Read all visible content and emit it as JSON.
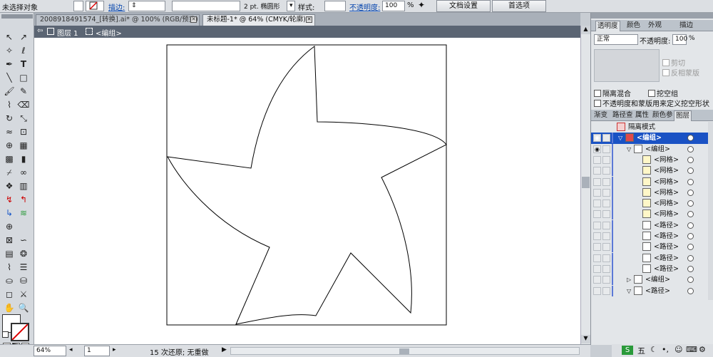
{
  "control_bar": {
    "selection_label": "未选择对象",
    "stroke_label": "描边:",
    "stroke_weight": "2 pt. 椭圆形",
    "style_label": "样式:",
    "opacity_label": "不透明度:",
    "opacity_value": "100",
    "percent": "%",
    "doc_settings_button": "文档设置",
    "preferences_button": "首选项"
  },
  "tabs": [
    {
      "label": "2008918491574_[转换].ai* @ 100% (RGB/预览)"
    },
    {
      "label": "未标题-1* @ 64% (CMYK/轮廓)"
    }
  ],
  "breadcrumb": {
    "layer": "图层 1",
    "group": "<编组>"
  },
  "status_bar": {
    "zoom": "64%",
    "page": "1",
    "undo_text": "15 次还原; 无重做"
  },
  "transparency_panel": {
    "tabs": [
      "透明度",
      "颜色",
      "外观",
      "描边"
    ],
    "blend_mode": "正常",
    "opacity_label": "不透明度:",
    "opacity_value": "100",
    "percent": "%",
    "clip_label": "剪切",
    "invert_mask_label": "反相蒙版",
    "isolate_blending": "隔离混合",
    "knockout_group": "挖空组",
    "opacity_mask_label": "不透明度和蒙版用来定义挖空形状"
  },
  "layers_panel": {
    "tabs": [
      "渐变",
      "路径查",
      "属性",
      "颜色参",
      "图层"
    ],
    "rows": [
      {
        "name": "隔离模式",
        "indent": 0
      },
      {
        "name": "<编组>",
        "indent": 1
      },
      {
        "name": "<编组>",
        "indent": 2
      },
      {
        "name": "<网格>",
        "indent": 3
      },
      {
        "name": "<网格>",
        "indent": 3
      },
      {
        "name": "<网格>",
        "indent": 3
      },
      {
        "name": "<网格>",
        "indent": 3
      },
      {
        "name": "<网格>",
        "indent": 3
      },
      {
        "name": "<网格>",
        "indent": 3
      },
      {
        "name": "<路径>",
        "indent": 3
      },
      {
        "name": "<路径>",
        "indent": 3
      },
      {
        "name": "<路径>",
        "indent": 3
      },
      {
        "name": "<路径>",
        "indent": 3
      },
      {
        "name": "<路径>",
        "indent": 3
      },
      {
        "name": "<编组>",
        "indent": 2
      },
      {
        "name": "<路径>",
        "indent": 2
      }
    ]
  },
  "taskbar": {
    "ime": "五"
  },
  "colors": {
    "selected_row": "#1a52c4",
    "accent": "#5b78d6"
  }
}
